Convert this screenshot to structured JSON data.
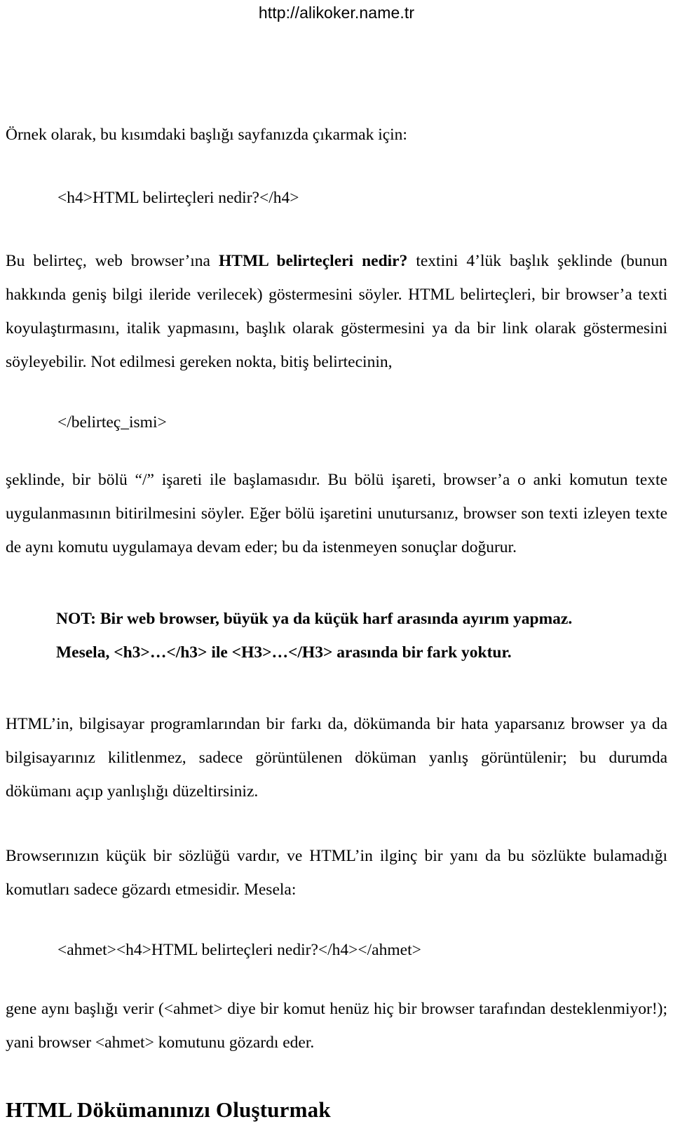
{
  "header": {
    "url": "http://alikoker.name.tr"
  },
  "body": {
    "intro_line": "Örnek olarak, bu kısımdaki başlığı sayfanızda çıkarmak için:",
    "code_h4": "<h4>HTML belirteçleri nedir?</h4>",
    "para1": {
      "part1": "Bu belirteç, web browser’ına ",
      "bold1": "HTML belirteçleri nedir?",
      "part2": " textini 4’lük başlık şeklinde (bunun hakkında geniş bilgi ileride verilecek) göstermesini söyler. HTML belirteçleri, bir browser’a texti koyulaştırmasını, italik yapmasını, başlık olarak göstermesini ya da bir link olarak göstermesini söyleyebilir. Not edilmesi gereken nokta, bitiş belirtecinin,"
    },
    "code_close": "</belirteç_ismi>",
    "para2": "şeklinde, bir bölü “/” işareti ile başlamasıdır. Bu bölü işareti, browser’a  o anki komutun texte uygulanmasının bitirilmesini söyler. Eğer bölü işaretini unutursanız, browser son texti izleyen texte de aynı komutu uygulamaya devam eder; bu da istenmeyen sonuçlar doğurur.",
    "note_line1": "NOT: Bir web browser, büyük ya da küçük harf arasında ayırım yapmaz.",
    "note_line2": "Mesela, <h3>…</h3> ile <H3>…</H3> arasında bir fark yoktur.",
    "para3": "HTML’in, bilgisayar programlarından bir farkı da, dökümanda bir hata yaparsanız browser ya da bilgisayarınız kilitlenmez, sadece görüntülenen döküman yanlış görüntülenir; bu durumda dökümanı açıp yanlışlığı düzeltirsiniz.",
    "para4": "Browserınızın küçük bir sözlüğü vardır, ve HTML’in ilginç bir yanı da bu sözlükte bulamadığı komutları sadece gözardı etmesidir. Mesela:",
    "code_ahmet": "<ahmet><h4>HTML belirteçleri nedir?</h4></ahmet>",
    "para5": "gene aynı başlığı verir (<ahmet> diye bir komut henüz hiç bir browser tarafından desteklenmiyor!); yani browser <ahmet> komutunu gözardı eder.",
    "section_heading": "HTML Dökümanınızı Oluşturmak"
  }
}
